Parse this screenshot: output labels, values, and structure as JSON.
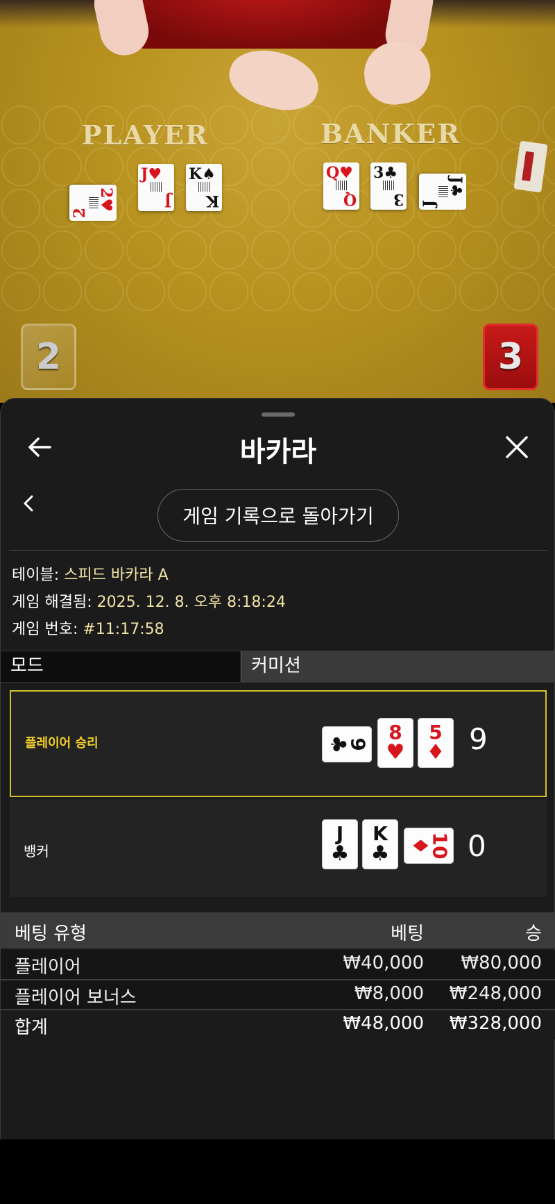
{
  "video": {
    "player_label": "PLAYER",
    "banker_label": "BANKER",
    "player_score": "2",
    "banker_score": "3",
    "player_cards": [
      {
        "rank": "2",
        "suit": "♥",
        "color": "red"
      },
      {
        "rank": "J",
        "suit": "♥",
        "color": "red"
      },
      {
        "rank": "K",
        "suit": "♠",
        "color": "black"
      }
    ],
    "banker_cards": [
      {
        "rank": "Q",
        "suit": "♥",
        "color": "red"
      },
      {
        "rank": "3",
        "suit": "♣",
        "color": "black"
      },
      {
        "rank": "J",
        "suit": "♣",
        "color": "black"
      }
    ]
  },
  "sheet": {
    "title": "바카라",
    "back_icon": "arrow-left-icon",
    "close_icon": "close-icon",
    "return_button": "게임 기록으로 돌아가기",
    "info": {
      "table_label": "테이블:",
      "table_value": "스피드 바카라 A",
      "resolved_label": "게임 해결됨:",
      "resolved_value": "2025. 12. 8. 오후 8:18:24",
      "game_no_label": "게임 번호:",
      "game_no_value": "#11:17:58"
    },
    "mode_label": "모드",
    "commission_label": "커미션"
  },
  "results": {
    "player": {
      "label": "플레이어 승리",
      "score": "9",
      "cards": [
        {
          "rank": "9",
          "suit": "♣",
          "color": "black",
          "sideways": true
        },
        {
          "rank": "8",
          "suit": "♥",
          "color": "red",
          "sideways": false
        },
        {
          "rank": "5",
          "suit": "♦",
          "color": "red",
          "sideways": false
        }
      ]
    },
    "banker": {
      "label": "뱅커",
      "score": "0",
      "cards": [
        {
          "rank": "J",
          "suit": "♣",
          "color": "black",
          "sideways": false
        },
        {
          "rank": "K",
          "suit": "♣",
          "color": "black",
          "sideways": false
        },
        {
          "rank": "10",
          "suit": "♦",
          "color": "red",
          "sideways": true
        }
      ]
    }
  },
  "bets": {
    "headers": {
      "type": "베팅 유형",
      "bet": "베팅",
      "win": "승"
    },
    "rows": [
      {
        "type": "플레이어",
        "bet": "₩40,000",
        "win": "₩80,000"
      },
      {
        "type": "플레이어 보너스",
        "bet": "₩8,000",
        "win": "₩248,000"
      }
    ],
    "total": {
      "type": "합계",
      "bet": "₩48,000",
      "win": "₩328,000"
    }
  },
  "colors": {
    "highlight_border": "#d8c02a",
    "winner_text": "#f1cf27",
    "info_value": "#f1e3a6",
    "card_red": "#d8141d"
  }
}
